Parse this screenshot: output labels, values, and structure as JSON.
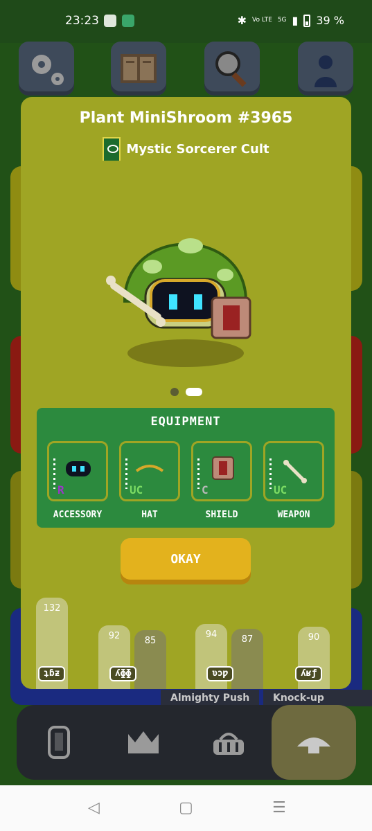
{
  "status": {
    "time": "23:23",
    "network": "5G",
    "volte": "Vo LTE",
    "battery": "39 %"
  },
  "top_menu": [
    "gears-icon",
    "book-icon",
    "magnifier-icon",
    "profile-icon"
  ],
  "modal": {
    "title": "Plant MiniShroom #3965",
    "guild": "Mystic Sorcerer Cult",
    "character": "green-mushroom-character",
    "carousel": {
      "count": 2,
      "active_index": 1
    },
    "equipment": {
      "title": "EQUIPMENT",
      "slots": [
        {
          "label": "ACCESSORY",
          "rarity": "R",
          "rarity_color": "#9b36c9",
          "icon": "goggles-icon"
        },
        {
          "label": "HAT",
          "rarity": "UC",
          "rarity_color": "#7bdc63",
          "icon": "halo-hat-icon"
        },
        {
          "label": "SHIELD",
          "rarity": "C",
          "rarity_color": "#b9b9b9",
          "icon": "rune-shield-icon"
        },
        {
          "label": "WEAPON",
          "rarity": "UC",
          "rarity_color": "#7bdc63",
          "icon": "bone-icon"
        }
      ]
    },
    "okay_label": "OKAY"
  },
  "stats": {
    "values": [
      "132",
      "92",
      "85",
      "94",
      "87",
      "90"
    ],
    "glyphs": [
      "ʇɓƶ",
      "ʎɸɸ",
      "ʋɔƿ",
      "ʎʁƒ"
    ]
  },
  "skills": [
    "Almighty Push",
    "Knock-up Stream"
  ],
  "bottom_nav": [
    "phone-icon",
    "crown-icon",
    "basket-icon",
    "mushroom-icon"
  ],
  "system_nav": {
    "back": "◁",
    "home": "▢",
    "menu": "☰"
  }
}
